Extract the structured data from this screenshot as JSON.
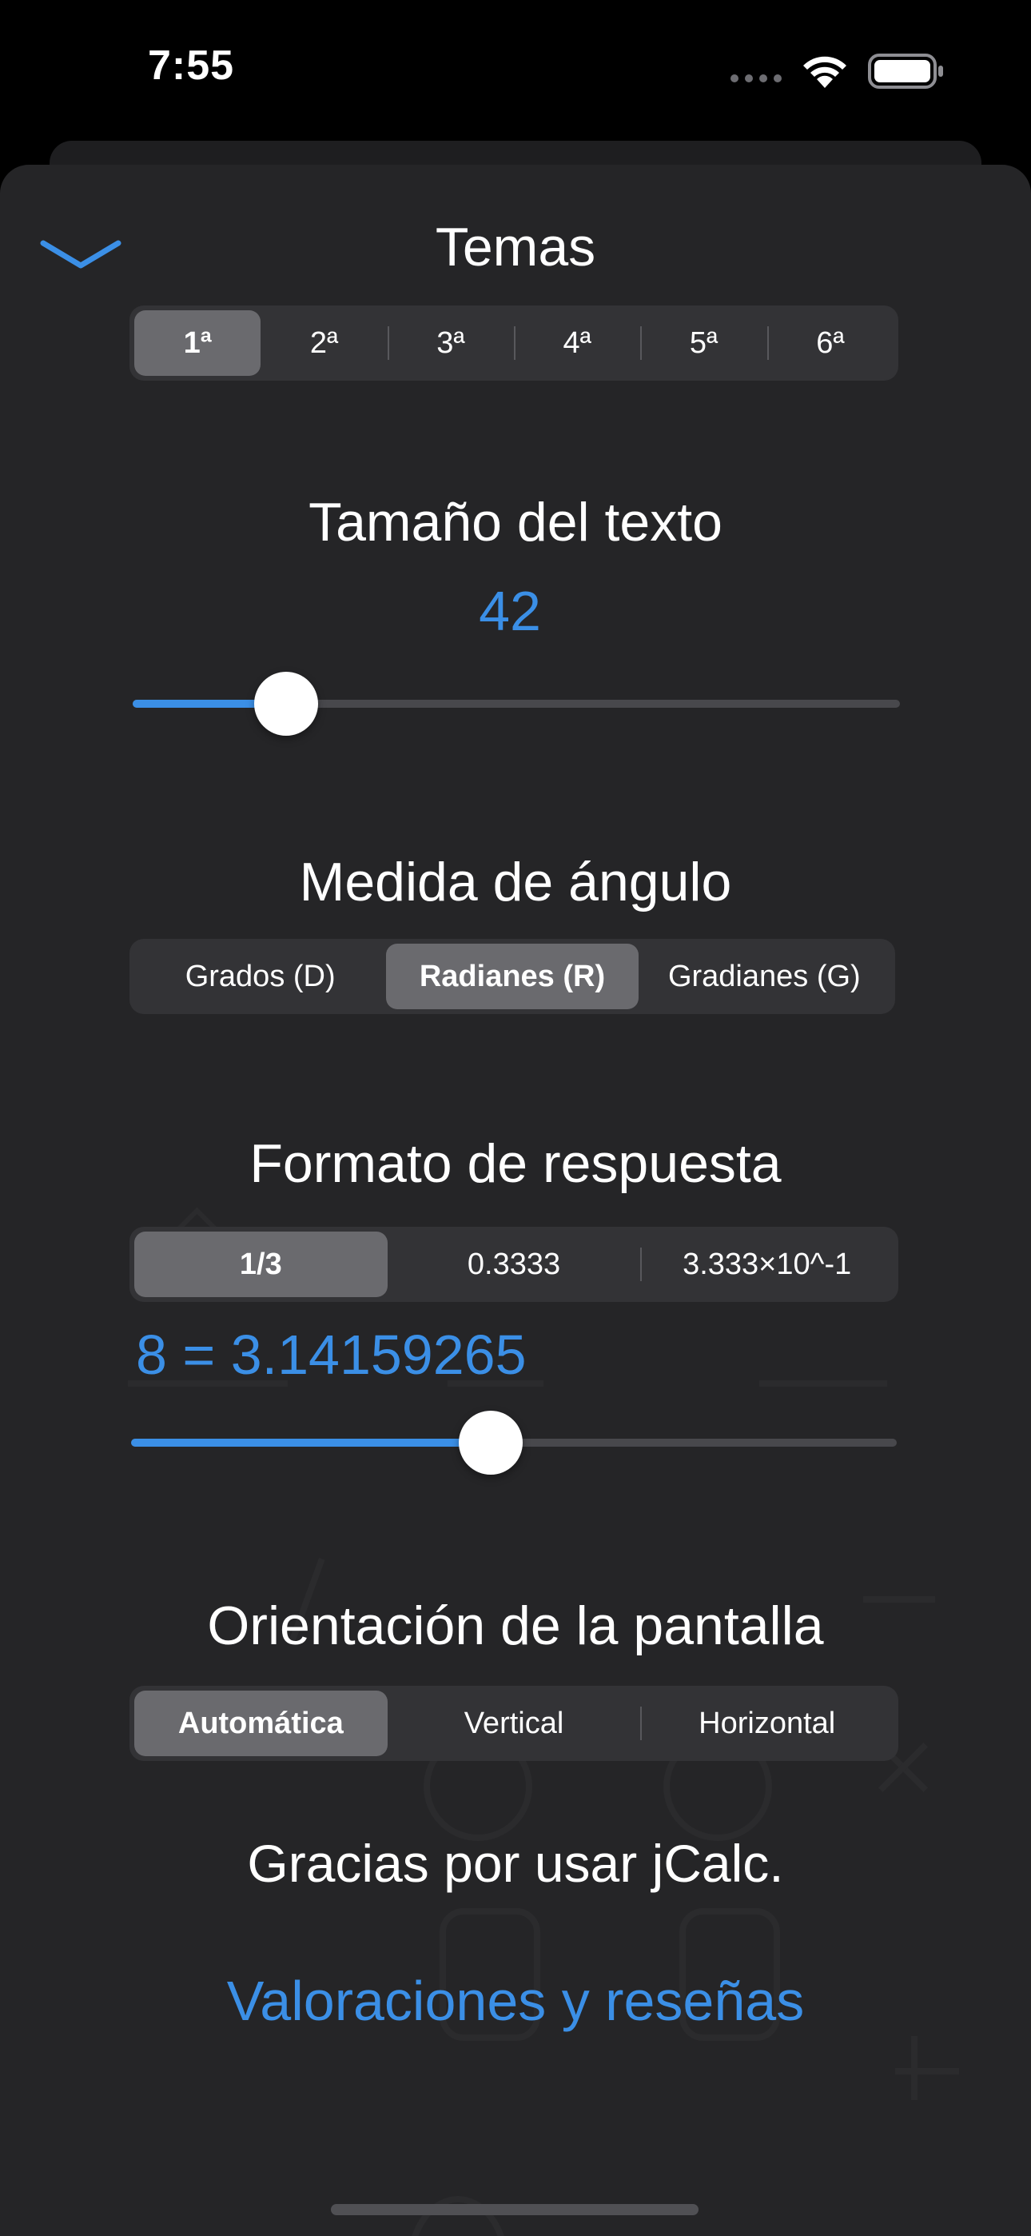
{
  "status_bar": {
    "time": "7:55"
  },
  "icons": {
    "collapse": "chevron-down-icon",
    "wifi": "wifi-icon",
    "battery": "battery-icon"
  },
  "themes": {
    "title": "Temas",
    "options": [
      "1ª",
      "2ª",
      "3ª",
      "4ª",
      "5ª",
      "6ª"
    ],
    "selected_index": 0
  },
  "text_size": {
    "title": "Tamaño del texto",
    "value": "42",
    "slider_fraction": 0.2
  },
  "angle": {
    "title": "Medida de ángulo",
    "options": [
      "Grados (D)",
      "Radianes (R)",
      "Gradianes (G)"
    ],
    "selected_index": 1
  },
  "answer_format": {
    "title": "Formato de respuesta",
    "options": [
      "1/3",
      "0.3333",
      "3.333×10^-1"
    ],
    "selected_index": 0,
    "preview": "8 = 3.14159265",
    "slider_fraction": 0.47
  },
  "orientation": {
    "title": "Orientación de la pantalla",
    "options": [
      "Automática",
      "Vertical",
      "Horizontal"
    ],
    "selected_index": 0
  },
  "footer": {
    "thanks": "Gracias por usar jCalc.",
    "rate_link": "Valoraciones y reseñas"
  },
  "colors": {
    "accent": "#3b8fe6",
    "sheet_background": "#252527",
    "segment_background": "#333336",
    "segment_selected": "#6a6a6e"
  }
}
